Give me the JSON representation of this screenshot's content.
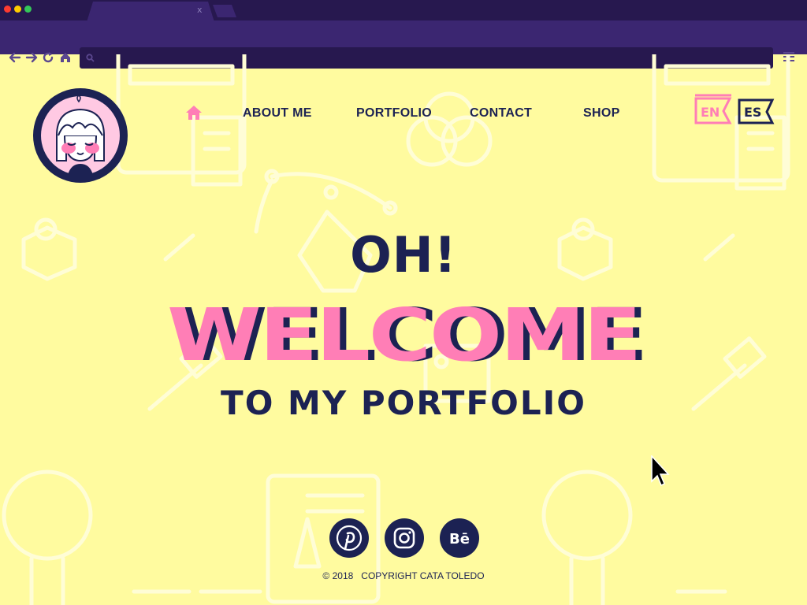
{
  "browser": {
    "tab_close": "x"
  },
  "nav": {
    "items": [
      {
        "label": "ABOUT ME"
      },
      {
        "label": "PORTFOLIO"
      },
      {
        "label": "CONTACT"
      },
      {
        "label": "SHOP"
      }
    ],
    "languages": [
      "EN",
      "ES"
    ]
  },
  "hero": {
    "line1": "OH!",
    "line2": "WELCOME",
    "line3": "TO MY PORTFOLIO"
  },
  "social": {
    "items": [
      {
        "icon": "pinterest-icon"
      },
      {
        "icon": "instagram-icon"
      },
      {
        "icon": "behance-icon",
        "label": "Bē"
      }
    ]
  },
  "footer": {
    "copyright": "© 2018   COPYRIGHT CATA TOLEDO"
  },
  "colors": {
    "background": "#fffb9f",
    "navy": "#1c2253",
    "pink": "#ff7eb6",
    "chrome_dark": "#27184f",
    "chrome": "#3b2671"
  }
}
